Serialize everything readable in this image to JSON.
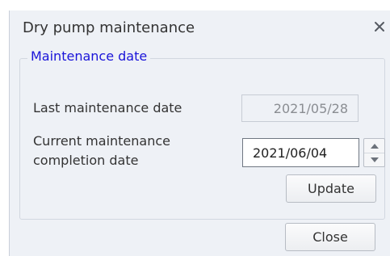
{
  "dialog": {
    "title": "Dry pump maintenance",
    "close_icon": "close-icon",
    "group": {
      "legend": "Maintenance date",
      "legend_color": "#1a14d9",
      "last_label": "Last maintenance date",
      "last_value": "2021/05/28",
      "current_label_line1": "Current maintenance",
      "current_label_line2": "completion date",
      "current_value": "2021/06/04",
      "spinner_up_icon": "triangle-up-icon",
      "spinner_down_icon": "triangle-down-icon",
      "update_label": "Update"
    },
    "close_label": "Close"
  }
}
